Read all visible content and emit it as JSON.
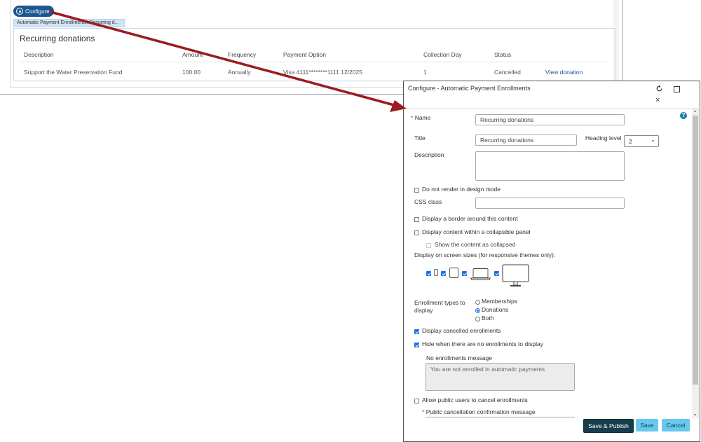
{
  "background_page": {
    "configure_label": "Configure",
    "part_tab_label": "Automatic Payment Enrollments: Recurring d...",
    "part_title": "Recurring donations",
    "table": {
      "headers": [
        "Description",
        "Amount",
        "Frequency",
        "Payment Option",
        "Collection Day",
        "Status"
      ],
      "row": {
        "description": "Support the Water Preservation Fund",
        "amount": "100.00",
        "frequency": "Annually",
        "payment_option": "Visa 4111********1111 12/2025",
        "collection_day": "1",
        "status": "Cancelled",
        "action": "View donation"
      }
    }
  },
  "annotation": {
    "arrow_color": "#9b1b20"
  },
  "dialog": {
    "title": "Configure - Automatic Payment Enrollments",
    "icons": [
      "refresh-icon",
      "maximize-icon",
      "close-icon",
      "help-icon"
    ],
    "close_glyph": "×",
    "help_glyph": "?",
    "name": {
      "label": "Name",
      "required_mark": "*",
      "value": "Recurring donations"
    },
    "title_field": {
      "label": "Title",
      "value": "Recurring donations"
    },
    "heading_level": {
      "label": "Heading level",
      "value": "2",
      "chevron": "⌄"
    },
    "description": {
      "label": "Description",
      "value": ""
    },
    "do_not_render": {
      "label": "Do not render in design mode",
      "checked": false
    },
    "css_class": {
      "label": "CSS class",
      "value": ""
    },
    "display_border": {
      "label": "Display a border around this content",
      "checked": false
    },
    "collapsible": {
      "label": "Display content within a collapsible panel",
      "checked": false
    },
    "show_collapsed": {
      "label": "Show the content as collapsed",
      "checked": false,
      "disabled": true
    },
    "screen_sizes": {
      "label": "Display on screen sizes (for responsive themes only):",
      "devices": [
        {
          "name": "phone",
          "checked": true
        },
        {
          "name": "tablet",
          "checked": true
        },
        {
          "name": "laptop",
          "checked": true
        },
        {
          "name": "desktop",
          "checked": true
        }
      ]
    },
    "enrollment_types": {
      "label": "Enrollment types to display",
      "options": [
        "Memberships",
        "Donations",
        "Both"
      ],
      "selected": "Donations"
    },
    "display_cancelled": {
      "label": "Display cancelled enrollments",
      "checked": true
    },
    "hide_when_none": {
      "label": "Hide when there are no enrollments to display",
      "checked": true
    },
    "no_enrollments_message": {
      "label": "No enrollments message",
      "placeholder": "You are not enrolled in automatic payments"
    },
    "allow_cancel": {
      "label": "Allow public users to cancel enrollments",
      "checked": false
    },
    "public_cancel_message": {
      "label": "Public cancellation confirmation message",
      "required_mark": "*"
    },
    "footer": {
      "save_publish": "Save & Publish",
      "save": "Save",
      "cancel": "Cancel"
    },
    "colors": {
      "primary_dark": "#163e4d",
      "secondary": "#66c8ec",
      "checkbox": "#1a73e8"
    }
  }
}
